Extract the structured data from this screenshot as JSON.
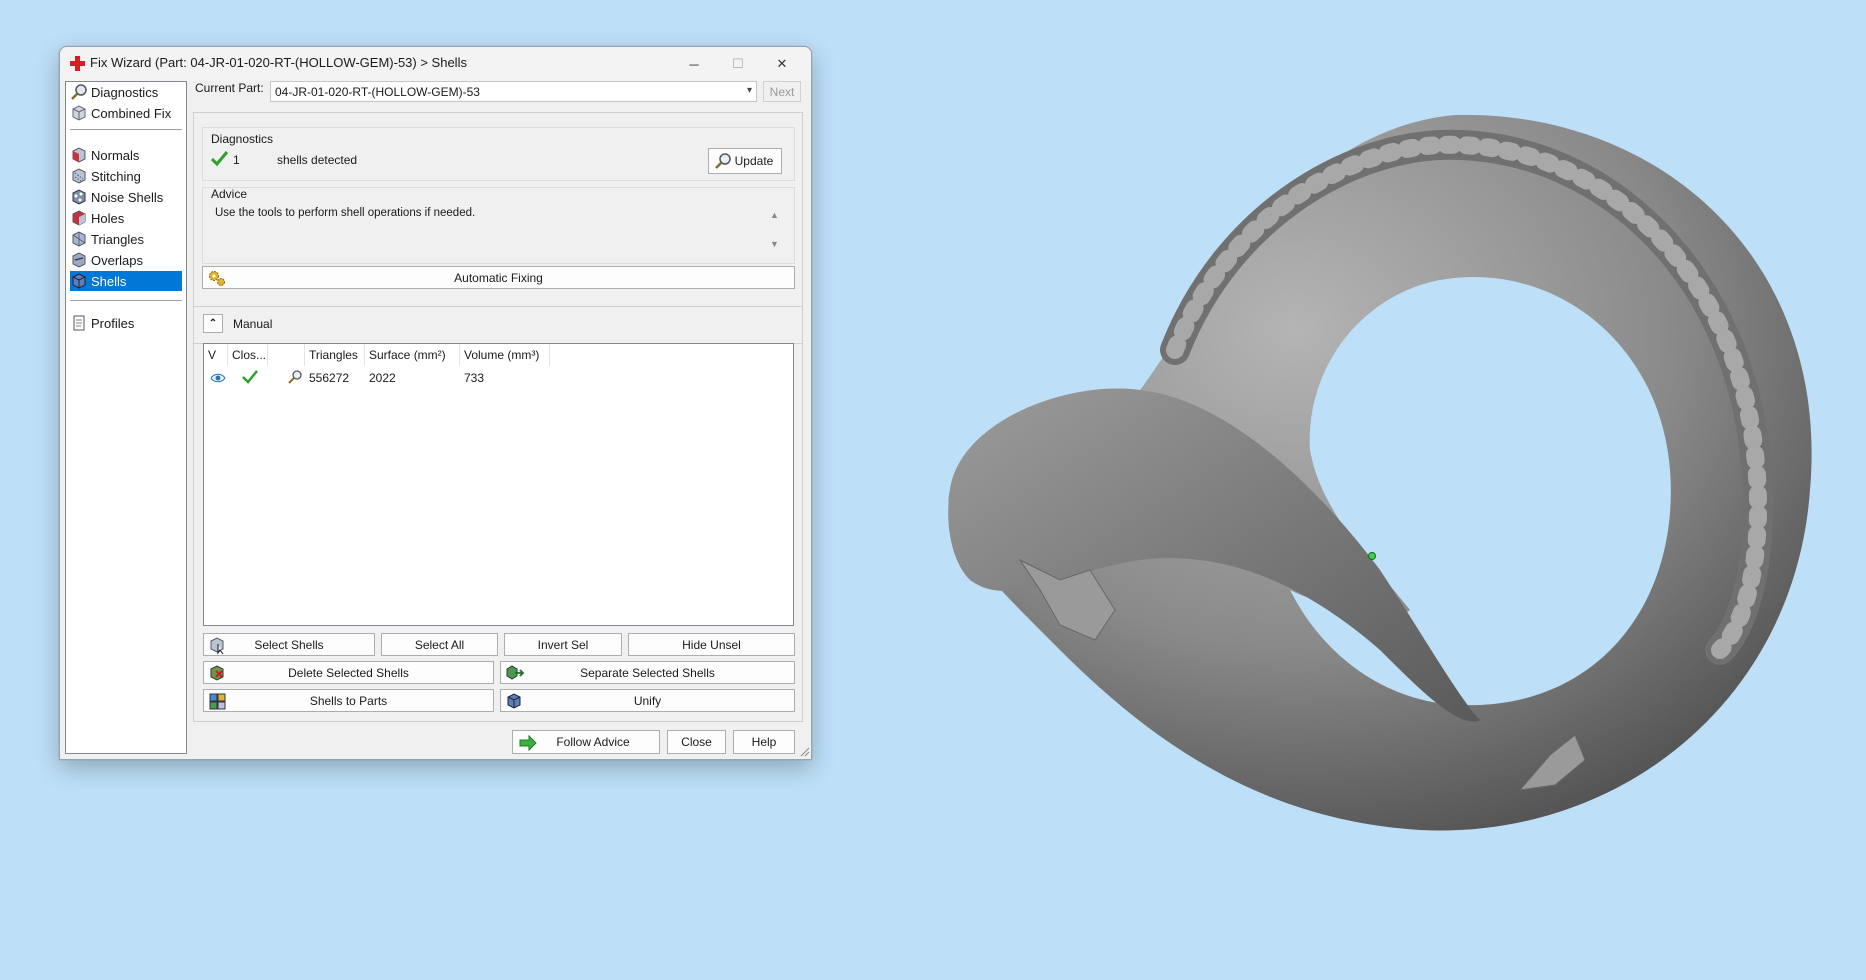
{
  "window": {
    "title": "Fix Wizard (Part: 04-JR-01-020-RT-(HOLLOW-GEM)-53) > Shells",
    "min_glyph": "─",
    "max_glyph": "☐",
    "close_glyph": "✕"
  },
  "nav": {
    "items": [
      {
        "label": "Diagnostics",
        "icon": "magnifier-icon"
      },
      {
        "label": "Combined Fix",
        "icon": "cube-icon"
      },
      {
        "label": "Normals",
        "icon": "normals-icon"
      },
      {
        "label": "Stitching",
        "icon": "stitching-icon"
      },
      {
        "label": "Noise Shells",
        "icon": "noise-shells-icon"
      },
      {
        "label": "Holes",
        "icon": "holes-icon"
      },
      {
        "label": "Triangles",
        "icon": "triangles-icon"
      },
      {
        "label": "Overlaps",
        "icon": "overlaps-icon"
      },
      {
        "label": "Shells",
        "icon": "shells-icon",
        "selected": true
      },
      {
        "label": "Profiles",
        "icon": "document-icon"
      }
    ]
  },
  "current_part": {
    "label": "Current Part:",
    "value": "04-JR-01-020-RT-(HOLLOW-GEM)-53",
    "next_label": "Next"
  },
  "diagnostics": {
    "title": "Diagnostics",
    "count": "1",
    "text": "shells detected",
    "update_label": "Update"
  },
  "advice": {
    "title": "Advice",
    "text": "Use the tools to perform shell operations if needed."
  },
  "automatic_fixing_label": "Automatic Fixing",
  "manual": {
    "title": "Manual",
    "table": {
      "headers": [
        "V",
        "Clos...",
        "",
        "Triangles",
        "Surface (mm²)",
        "Volume (mm³)"
      ],
      "rows": [
        {
          "visible": true,
          "closed": true,
          "triangles": "556272",
          "surface": "2022",
          "volume": "733"
        }
      ]
    },
    "buttons": {
      "select_shells": "Select Shells",
      "select_all": "Select All",
      "invert_sel": "Invert Sel",
      "hide_unsel": "Hide Unsel",
      "delete_selected": "Delete Selected Shells",
      "separate_selected": "Separate Selected Shells",
      "shells_to_parts": "Shells to Parts",
      "unify": "Unify"
    }
  },
  "footer": {
    "follow_advice": "Follow Advice",
    "close": "Close",
    "help": "Help"
  },
  "colors": {
    "desktop": "#bddff7",
    "selection": "#0078d7",
    "check_green": "#2e9e2e",
    "model_gray": "#8a8a8a"
  }
}
